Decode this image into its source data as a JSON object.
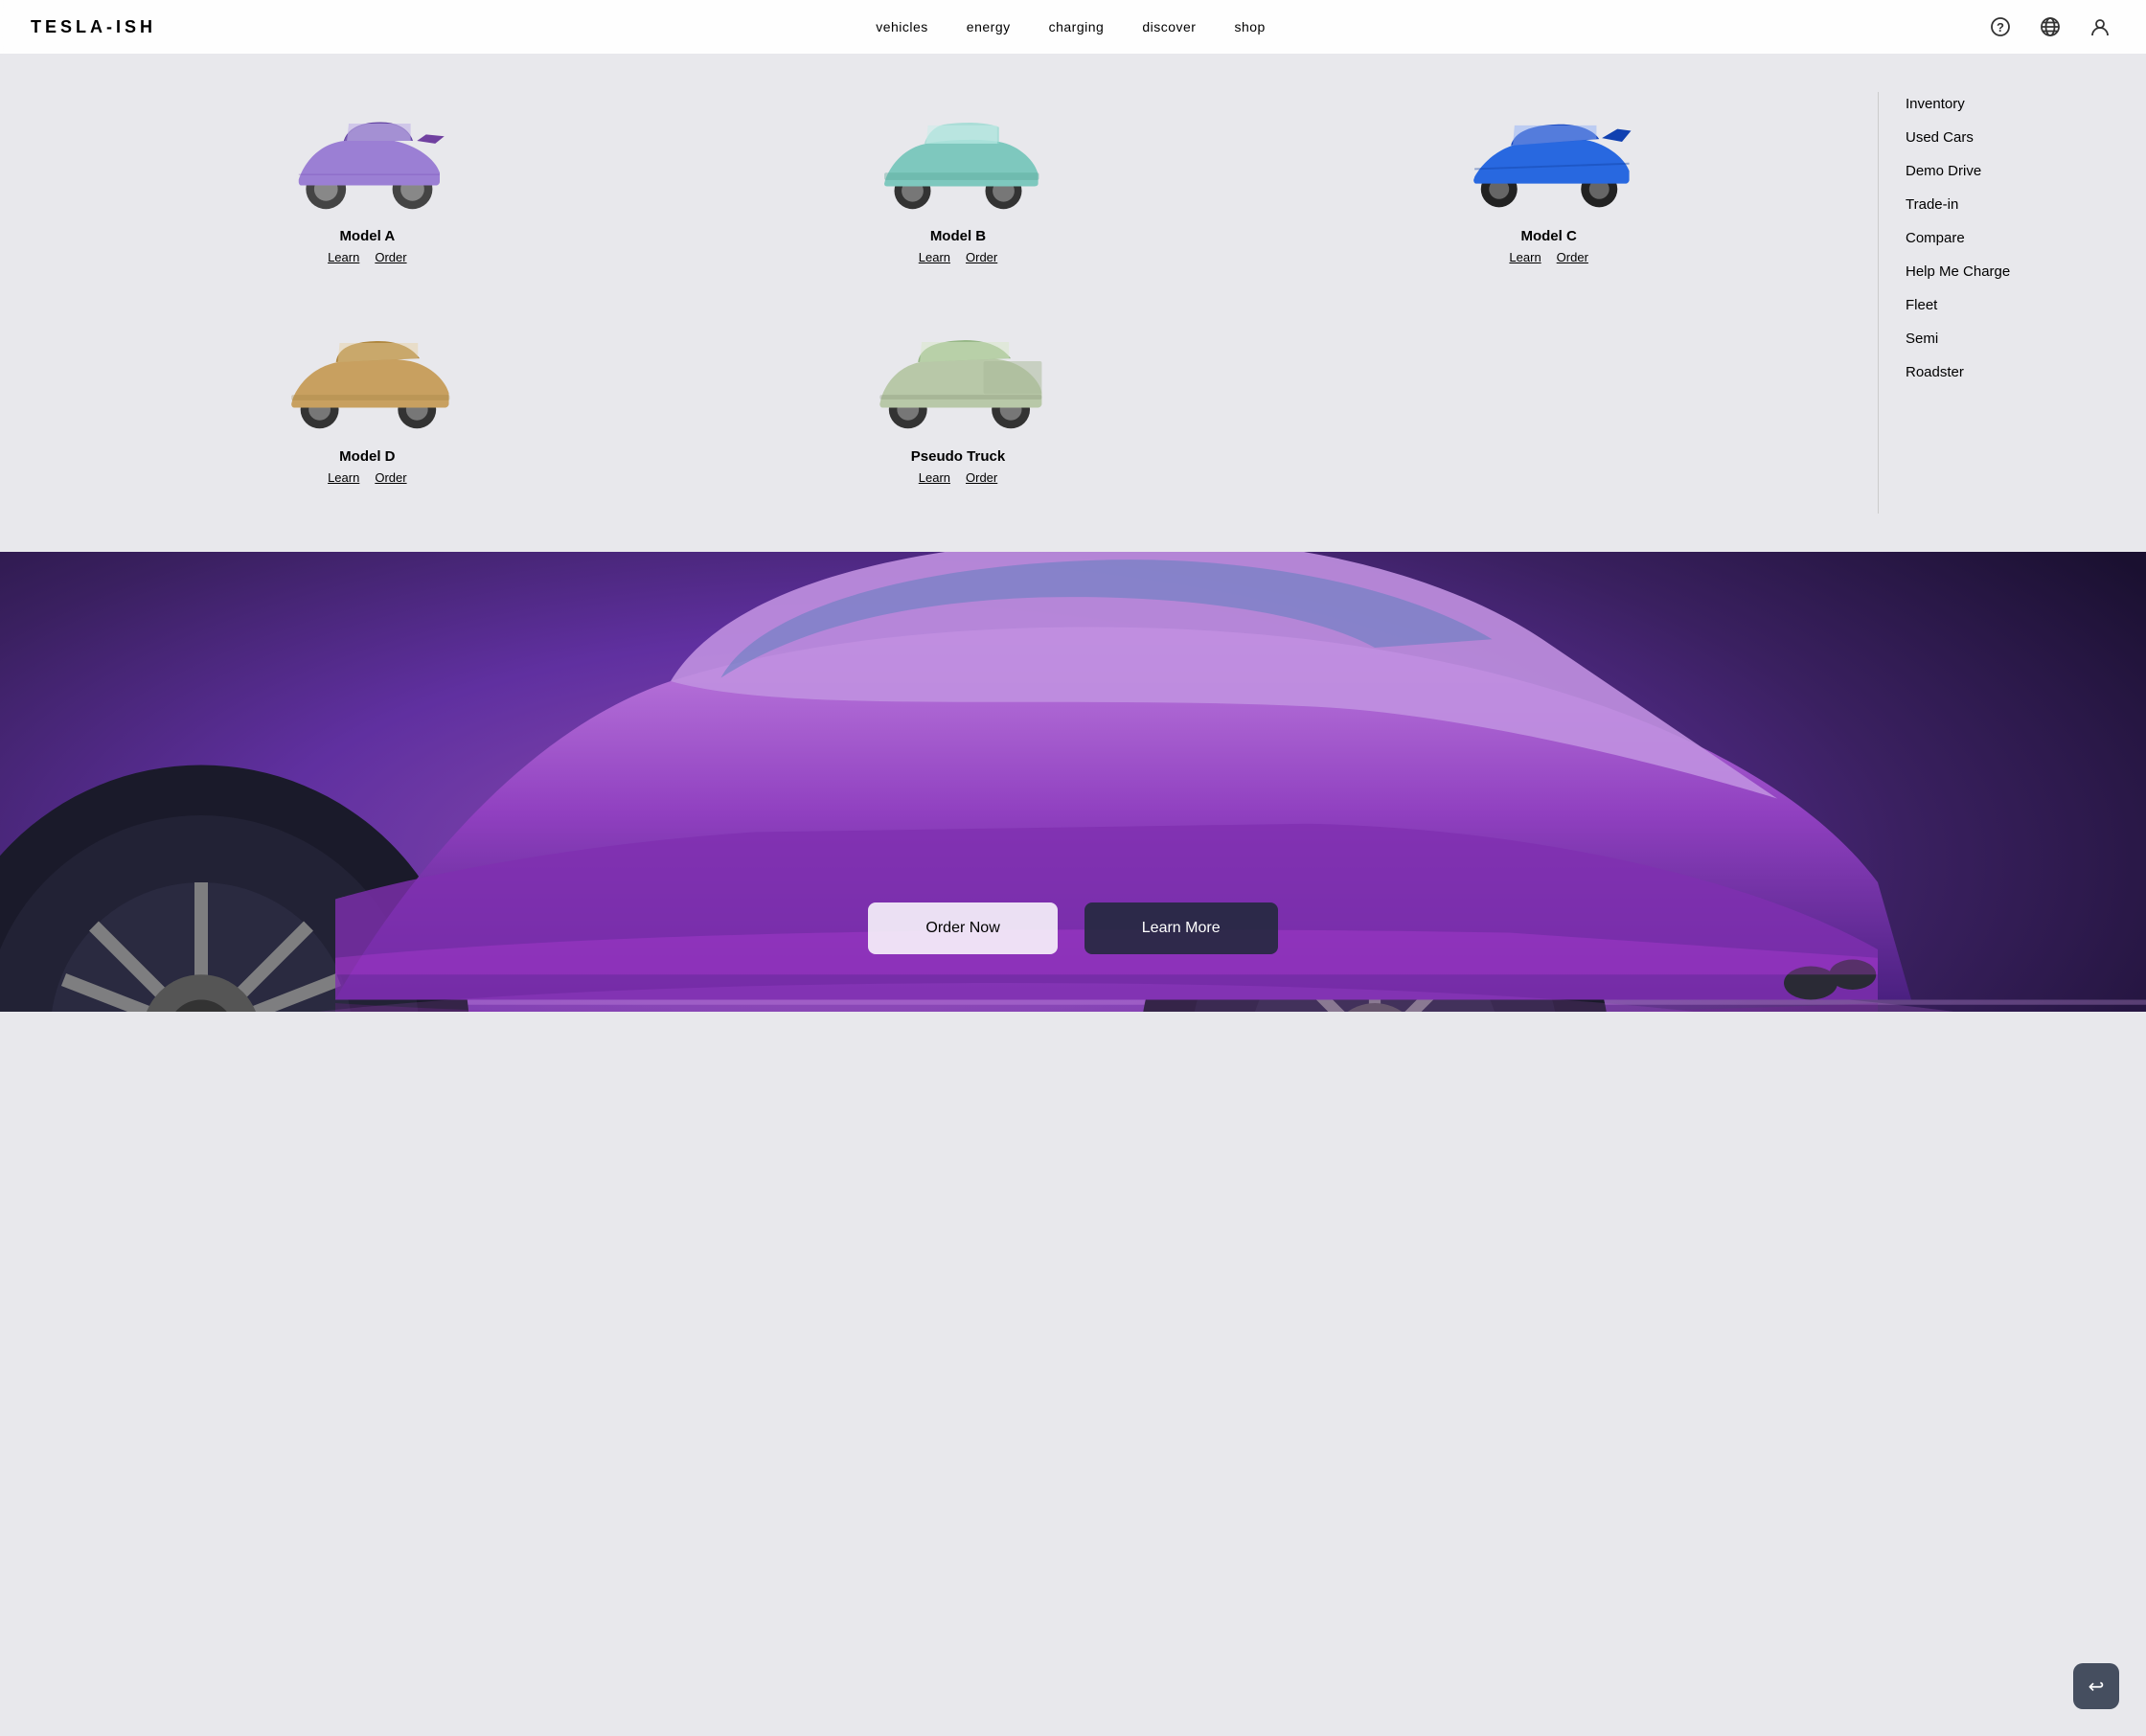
{
  "header": {
    "logo": "TESLA-ISH",
    "nav": [
      {
        "label": "vehicles",
        "id": "vehicles"
      },
      {
        "label": "energy",
        "id": "energy"
      },
      {
        "label": "charging",
        "id": "charging"
      },
      {
        "label": "discover",
        "id": "discover"
      },
      {
        "label": "shop",
        "id": "shop"
      }
    ],
    "icons": {
      "help": "?",
      "globe": "🌐",
      "user": "👤"
    }
  },
  "dropdown": {
    "vehicles": [
      {
        "name": "Model A",
        "learn_label": "Learn",
        "order_label": "Order",
        "color": "#9b7fd4",
        "type": "sedan"
      },
      {
        "name": "Model B",
        "learn_label": "Learn",
        "order_label": "Order",
        "color": "#7ec8be",
        "type": "suv"
      },
      {
        "name": "Model C",
        "learn_label": "Learn",
        "order_label": "Order",
        "color": "#3070d8",
        "type": "sports"
      },
      {
        "name": "Model D",
        "learn_label": "Learn",
        "order_label": "Order",
        "color": "#c8a060",
        "type": "crossover"
      },
      {
        "name": "Pseudo Truck",
        "learn_label": "Learn",
        "order_label": "Order",
        "color": "#b8c8a8",
        "type": "truck"
      }
    ],
    "sidebar": [
      {
        "label": "Inventory"
      },
      {
        "label": "Used Cars"
      },
      {
        "label": "Demo Drive"
      },
      {
        "label": "Trade-in"
      },
      {
        "label": "Compare"
      },
      {
        "label": "Help Me Charge"
      },
      {
        "label": "Fleet"
      },
      {
        "label": "Semi"
      },
      {
        "label": "Roadster"
      }
    ]
  },
  "hero": {
    "order_label": "Order Now",
    "learn_label": "Learn More"
  },
  "back_btn_icon": "↩"
}
